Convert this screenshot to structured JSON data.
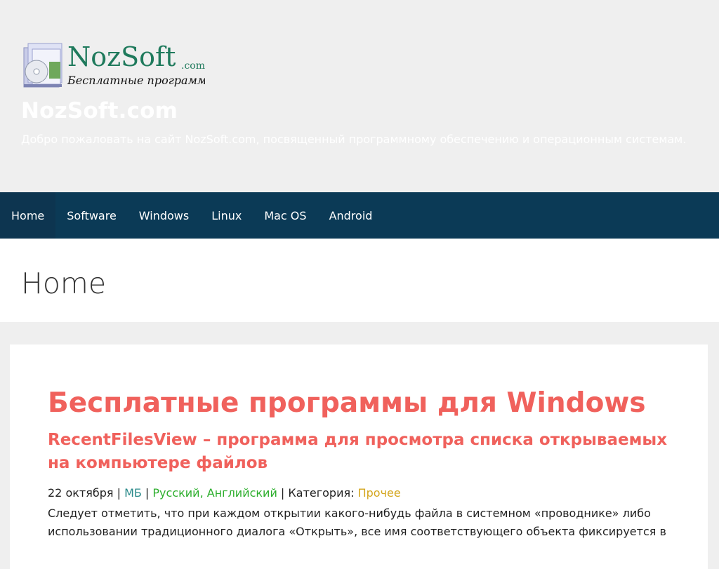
{
  "header": {
    "logo": {
      "brand": "NozSoft",
      "domain": ".com",
      "tagline": "Бесплатные программы"
    },
    "site_title": "NozSoft.com",
    "site_description": "Добро пожаловать на сайт NozSoft.com, посвященный программному обеспечению и операционным системам."
  },
  "nav": {
    "items": [
      {
        "label": "Home"
      },
      {
        "label": "Software"
      },
      {
        "label": "Windows"
      },
      {
        "label": "Linux"
      },
      {
        "label": "Mac OS"
      },
      {
        "label": "Android"
      }
    ]
  },
  "page": {
    "title": "Home"
  },
  "content": {
    "section_heading": "Бесплатные программы для Windows",
    "post": {
      "title": "RecentFilesView – программа для просмотра списка открываемых на компьютере файлов",
      "date": "22 октября",
      "sep": " | ",
      "size": "МБ",
      "languages": "Русский, Английский",
      "category_label": "Категория: ",
      "category": "Прочее",
      "excerpt": "Следует отметить, что при каждом открытии какого-нибудь файла в системном «проводнике» либо использовании традиционного диалога «Открыть», все имя соответствующего объекта фиксируется в"
    }
  },
  "colors": {
    "nav_bg": "#0b3a56",
    "accent_heading": "#f0615c",
    "meta_size": "#2a8a8a",
    "meta_language": "#2cae2c",
    "meta_category": "#d4a61e"
  }
}
